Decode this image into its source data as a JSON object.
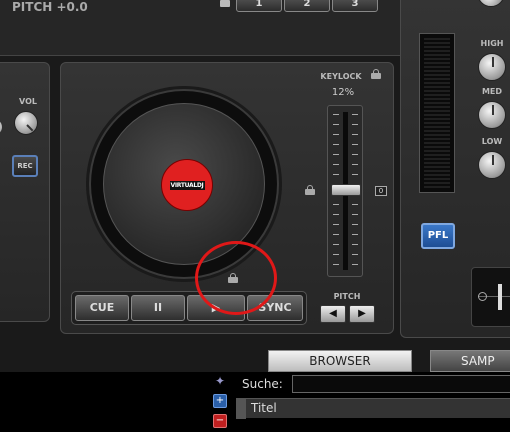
{
  "top": {
    "pitch_readout": "PITCH +0.0",
    "hotcues": [
      "1",
      "2",
      "3"
    ]
  },
  "left_deck": {
    "vol_label": "VOL",
    "rec_label": "REC"
  },
  "deck": {
    "platter_logo": "VIRTUALDJ",
    "keylock_label": "KEYLOCK",
    "pitch_range": "12%",
    "slider_value_marker": "0",
    "pitch_label": "PITCH",
    "cue_label": "CUE",
    "pause_glyph": "II",
    "play_glyph": "▶",
    "sync_label": "SYNC",
    "pitch_bend_left": "◀",
    "pitch_bend_right": "▶"
  },
  "mixer": {
    "high_label": "HIGH",
    "med_label": "MED",
    "low_label": "LOW",
    "pfl_label": "PFL"
  },
  "tabs": {
    "browser": "BROWSER",
    "sampler": "SAMP"
  },
  "browser": {
    "search_label": "Suche:",
    "search_value": "",
    "column_title": "Titel"
  },
  "colors": {
    "accent_blue": "#2a5fa8",
    "platter_red": "#e02020",
    "annotation_red": "#e01818"
  }
}
